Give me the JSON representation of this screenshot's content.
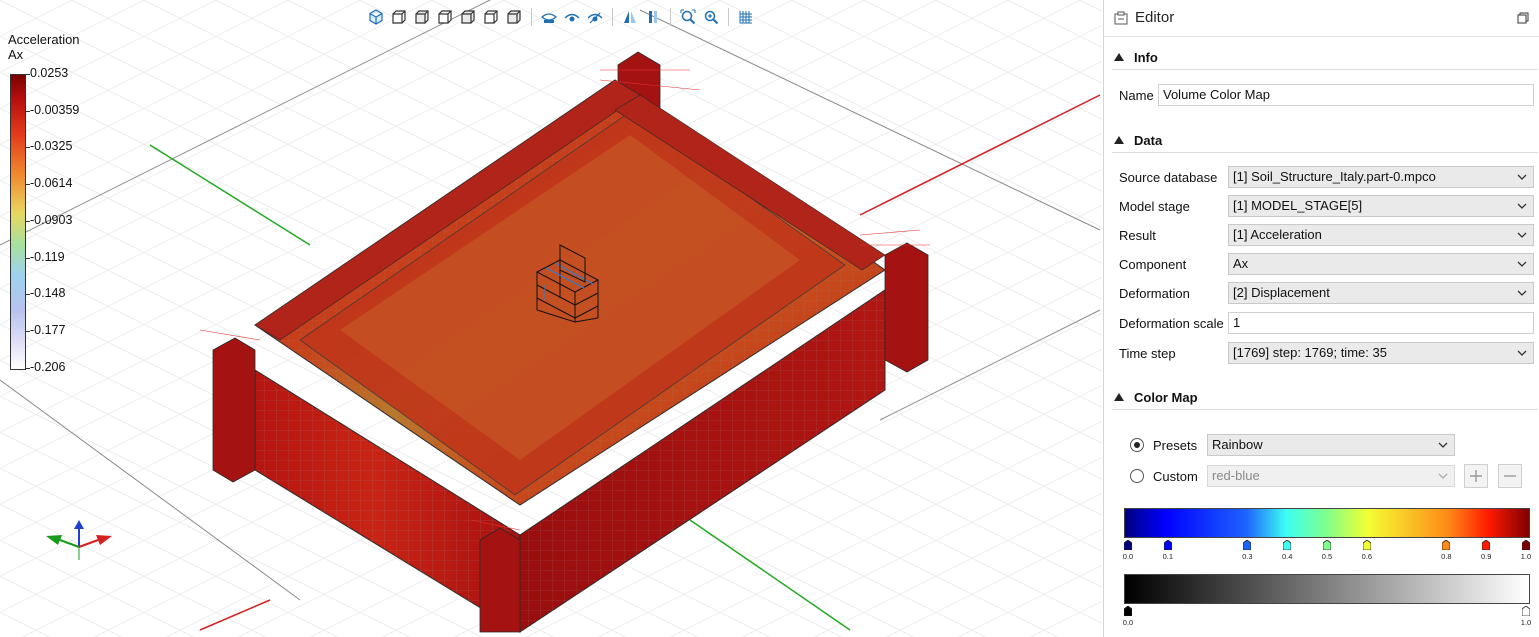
{
  "legend": {
    "title_line1": "Acceleration",
    "title_line2": "Ax",
    "ticks": [
      "0.0253",
      "-0.00359",
      "-0.0325",
      "-0.0614",
      "-0.0903",
      "-0.119",
      "-0.148",
      "-0.177",
      "-0.206"
    ]
  },
  "toolbar": {
    "icons": [
      "view-iso-icon",
      "view-front-icon",
      "view-back-icon",
      "view-left-icon",
      "view-right-icon",
      "view-top-icon",
      "view-bottom-icon",
      "show-surface-icon",
      "eye-icon",
      "eye-hidden-icon",
      "mirror-icon",
      "columns-icon",
      "zoom-fit-icon",
      "zoom-icon",
      "grid-icon"
    ]
  },
  "editor": {
    "title": "Editor",
    "info": {
      "header": "Info",
      "name_label": "Name",
      "name_value": "Volume Color Map"
    },
    "data": {
      "header": "Data",
      "source_label": "Source database",
      "source_value": "[1] Soil_Structure_Italy.part-0.mpco",
      "stage_label": "Model stage",
      "stage_value": "[1] MODEL_STAGE[5]",
      "result_label": "Result",
      "result_value": "[1] Acceleration",
      "component_label": "Component",
      "component_value": "Ax",
      "deformation_label": "Deformation",
      "deformation_value": "[2] Displacement",
      "scale_label": "Deformation scale",
      "scale_value": "1",
      "timestep_label": "Time step",
      "timestep_value": "[1769] step: 1769; time: 35"
    },
    "colormap": {
      "header": "Color Map",
      "presets_label": "Presets",
      "presets_value": "Rainbow",
      "custom_label": "Custom",
      "custom_value": "red-blue",
      "rainbow_stops": [
        "0.0",
        "0.1",
        "0.3",
        "0.4",
        "0.5",
        "0.6",
        "0.8",
        "0.9",
        "1.0"
      ],
      "rainbow_colors": [
        "#00007f",
        "#0000ff",
        "#1e63ff",
        "#3dfff2",
        "#7fff8a",
        "#f2ff33",
        "#ff8a17",
        "#ff1a00",
        "#7f0000"
      ],
      "gray_stops": [
        "0.0",
        "1.0"
      ],
      "gray_colors": [
        "#000000",
        "#ffffff"
      ]
    }
  },
  "axes_colors": {
    "x": "#d42020",
    "y": "#1a9a1a",
    "z": "#1f3fd0"
  }
}
